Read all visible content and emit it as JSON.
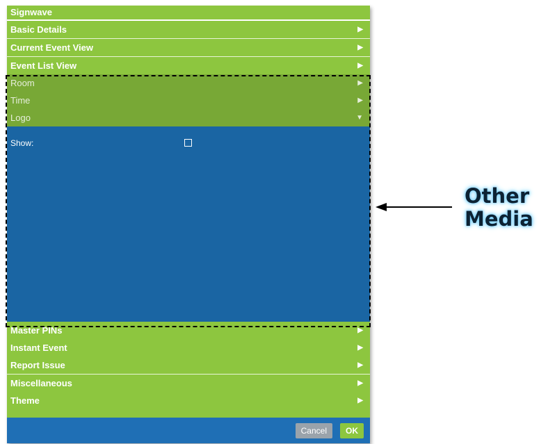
{
  "panel": {
    "title": "Signwave",
    "rows_top": [
      {
        "label": "Basic Details",
        "arrow": "▶"
      },
      {
        "label": "Current Event View",
        "arrow": "▶"
      },
      {
        "label": "Event List View",
        "arrow": "▶"
      },
      {
        "label": "Room",
        "arrow": "▶"
      },
      {
        "label": "Time",
        "arrow": "▶"
      },
      {
        "label": "Logo",
        "arrow": "▼"
      }
    ],
    "logo_content": {
      "show_label": "Show:",
      "show_checked": false
    },
    "rows_bottom": [
      {
        "label": "Master PINs",
        "arrow": "▶"
      },
      {
        "label": "Instant Event",
        "arrow": "▶"
      },
      {
        "label": "Report Issue",
        "arrow": "▶"
      },
      {
        "label": "Miscellaneous",
        "arrow": "▶"
      },
      {
        "label": "Theme",
        "arrow": "▶"
      }
    ],
    "footer": {
      "cancel_label": "Cancel",
      "ok_label": "OK"
    }
  },
  "annotation": {
    "line1": "Other",
    "line2": "Media"
  },
  "colors": {
    "green": "#8dc63f",
    "dim_green": "#78a836",
    "blue": "#1a65a3",
    "footer_blue": "#1f6fb5"
  }
}
